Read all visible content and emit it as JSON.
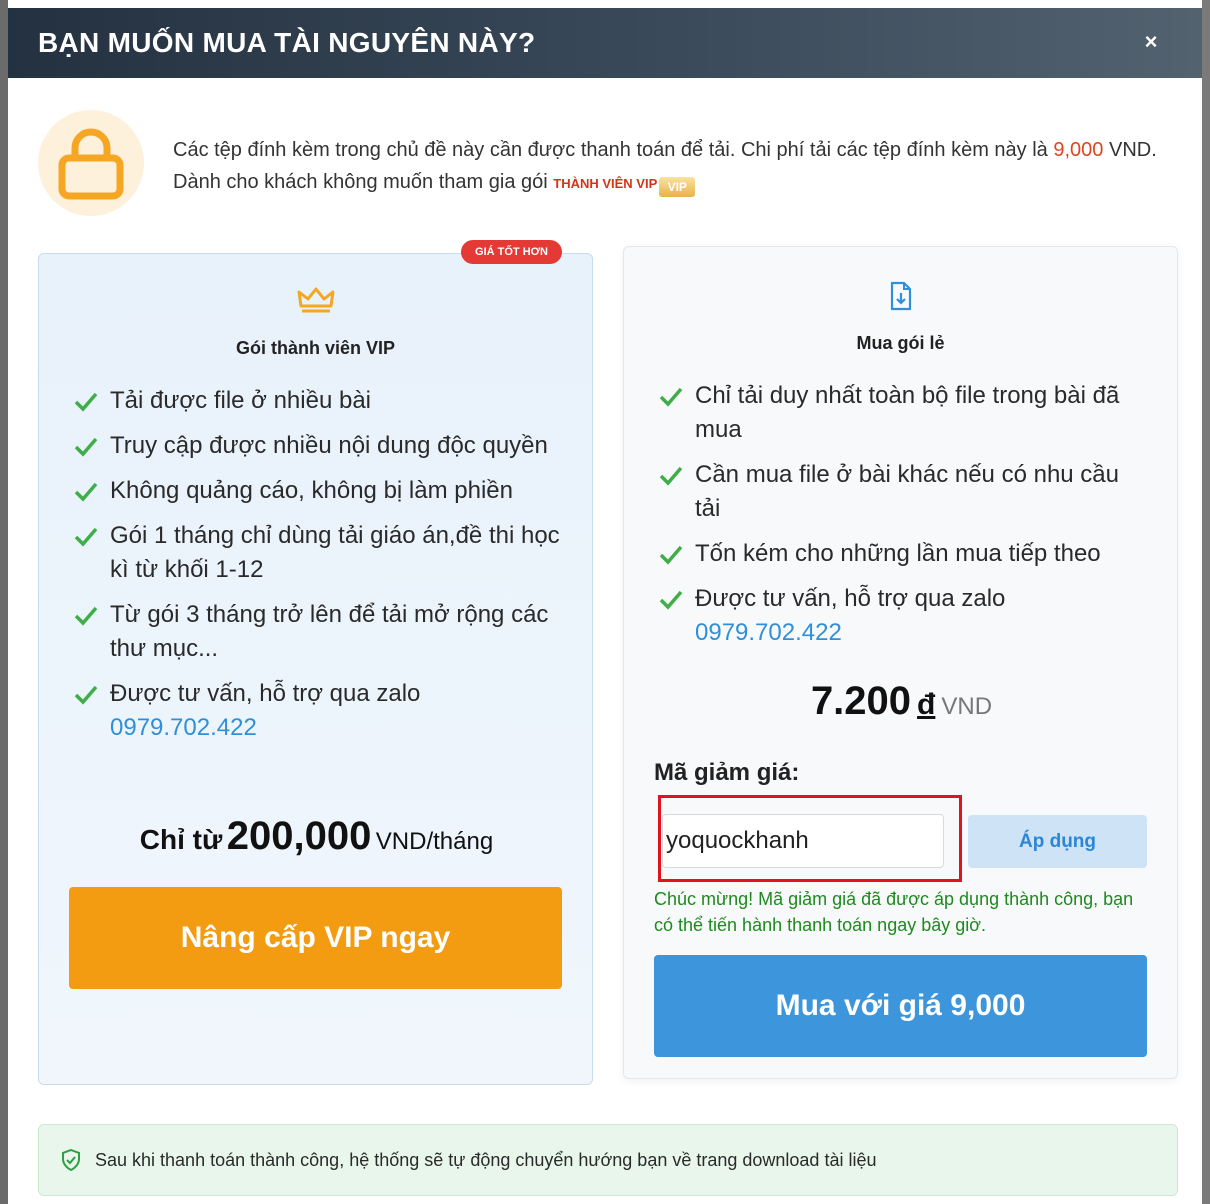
{
  "header": {
    "title": "BẠN MUỐN MUA TÀI NGUYÊN NÀY?",
    "close": "×"
  },
  "intro": {
    "text_before": "Các tệp đính kèm trong chủ đề này cần được thanh toán để tải. Chi phí tải các tệp đính kèm này là ",
    "price": "9,000",
    "text_after": " VND. Dành cho khách không muốn tham gia gói ",
    "vip_label": "THÀNH VIÊN VIP",
    "vip_badge": "VIP"
  },
  "vip_card": {
    "badge": "GIÁ TỐT HƠN",
    "title": "Gói thành viên VIP",
    "features": [
      "Tải được file ở nhiều bài",
      "Truy cập được nhiều nội dung độc quyền",
      "Không quảng cáo, không bị làm phiền",
      "Gói 1 tháng chỉ dùng tải giáo án,đề thi học kì từ khối 1-12",
      "Từ gói 3 tháng trở lên để tải mở rộng các thư mục...",
      "Được tư vấn, hỗ trợ qua zalo"
    ],
    "phone": "0979.702.422",
    "price_lead": "Chỉ từ",
    "price_amount": "200,000",
    "price_unit": "VND/tháng",
    "button": "Nâng cấp VIP ngay"
  },
  "single_card": {
    "title": "Mua gói lẻ",
    "features": [
      "Chỉ tải duy nhất toàn bộ file trong bài đã mua",
      "Cần mua file ở bài khác nếu có nhu cầu tải",
      "Tốn kém cho những lần mua tiếp theo",
      "Được tư vấn, hỗ trợ qua zalo"
    ],
    "phone": "0979.702.422",
    "price_amount": "7.200",
    "price_currency": "đ",
    "price_unit": "VND",
    "coupon_label": "Mã giảm giá:",
    "coupon_value": "yoquockhanh",
    "apply_button": "Áp dụng",
    "success_message": "Chúc mừng! Mã giảm giá đã được áp dụng thành công, bạn có thể tiến hành thanh toán ngay bây giờ.",
    "buy_button": "Mua với giá 9,000"
  },
  "notice": {
    "text": "Sau khi thanh toán thành công, hệ thống sẽ tự động chuyển hướng bạn về trang download tài liệu"
  },
  "colors": {
    "vip_button": "#f39c12",
    "buy_button": "#3d95db",
    "badge": "#e53935",
    "success": "#1e8a1e",
    "highlight": "#e1141d"
  }
}
